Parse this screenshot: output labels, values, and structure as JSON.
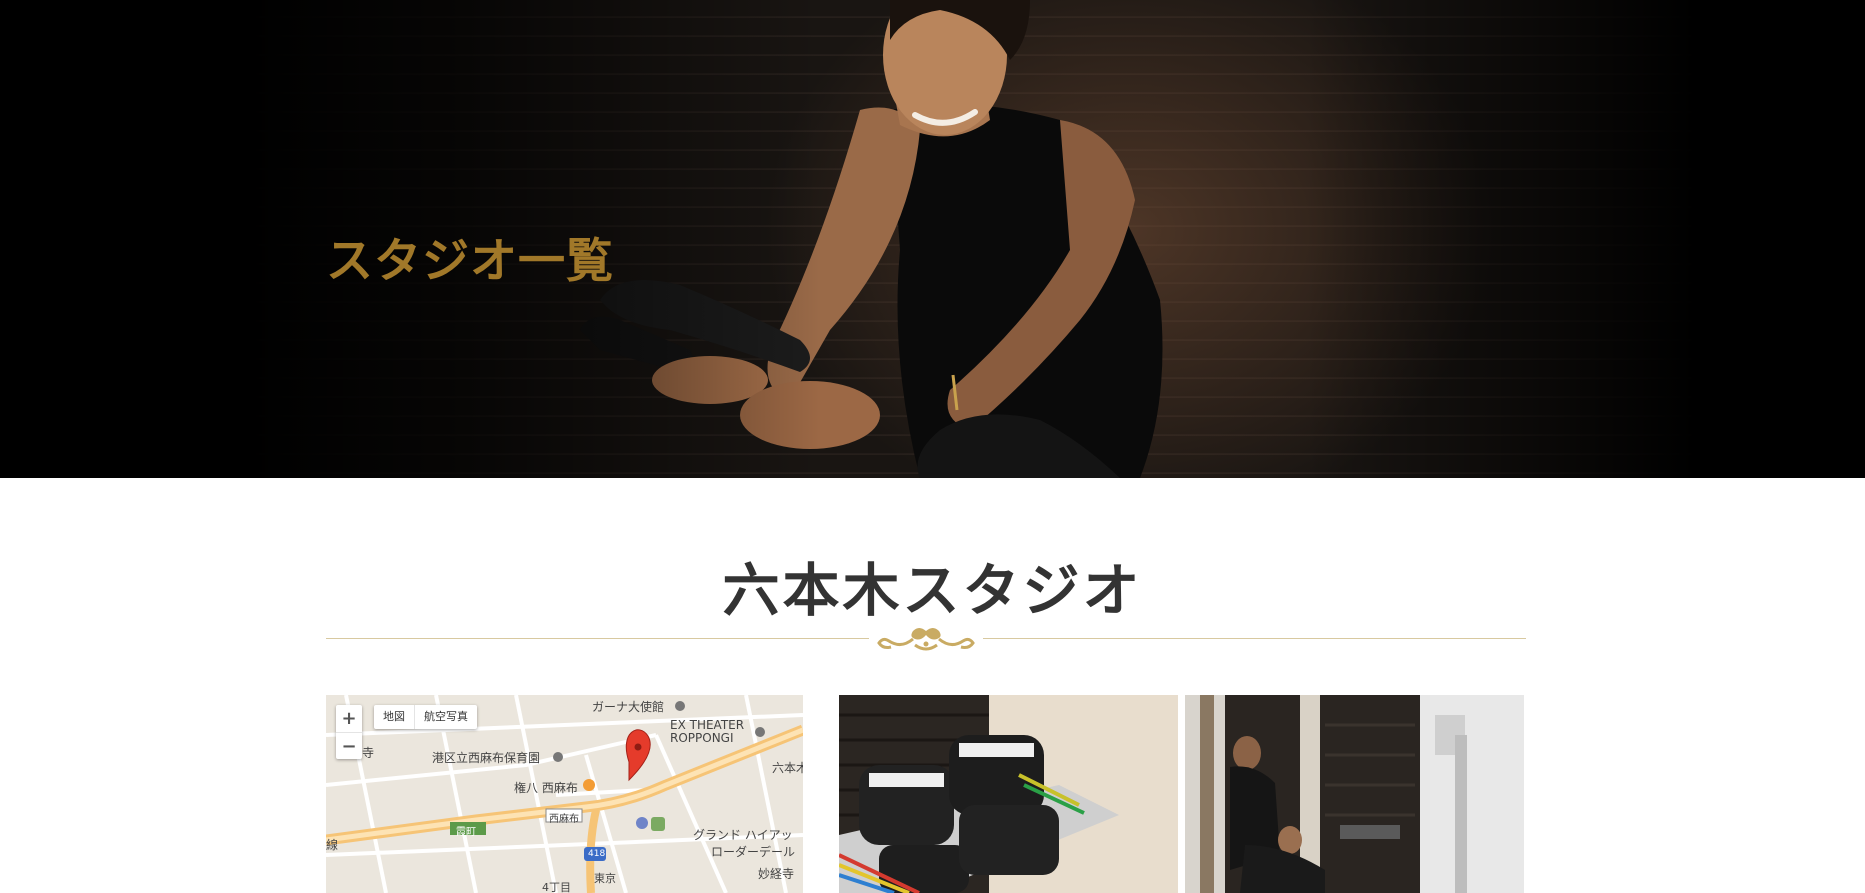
{
  "hero": {
    "title": "スタジオ一覧"
  },
  "studio": {
    "name": "六本木スタジオ",
    "map": {
      "zoom_in": "+",
      "zoom_out": "−",
      "map_types": [
        "地図",
        "航空写真"
      ],
      "labels": [
        "ガーナ大使館",
        "EX THEATER",
        "ROPPONGI",
        "港区立西麻布保育園",
        "権八 西麻布",
        "西麻布",
        "霞町",
        "グランド ハイアッ",
        "ローダーデール",
        "妙経寺",
        "六本木",
        "418",
        "4丁目",
        "寺",
        "線",
        "東京"
      ]
    }
  }
}
